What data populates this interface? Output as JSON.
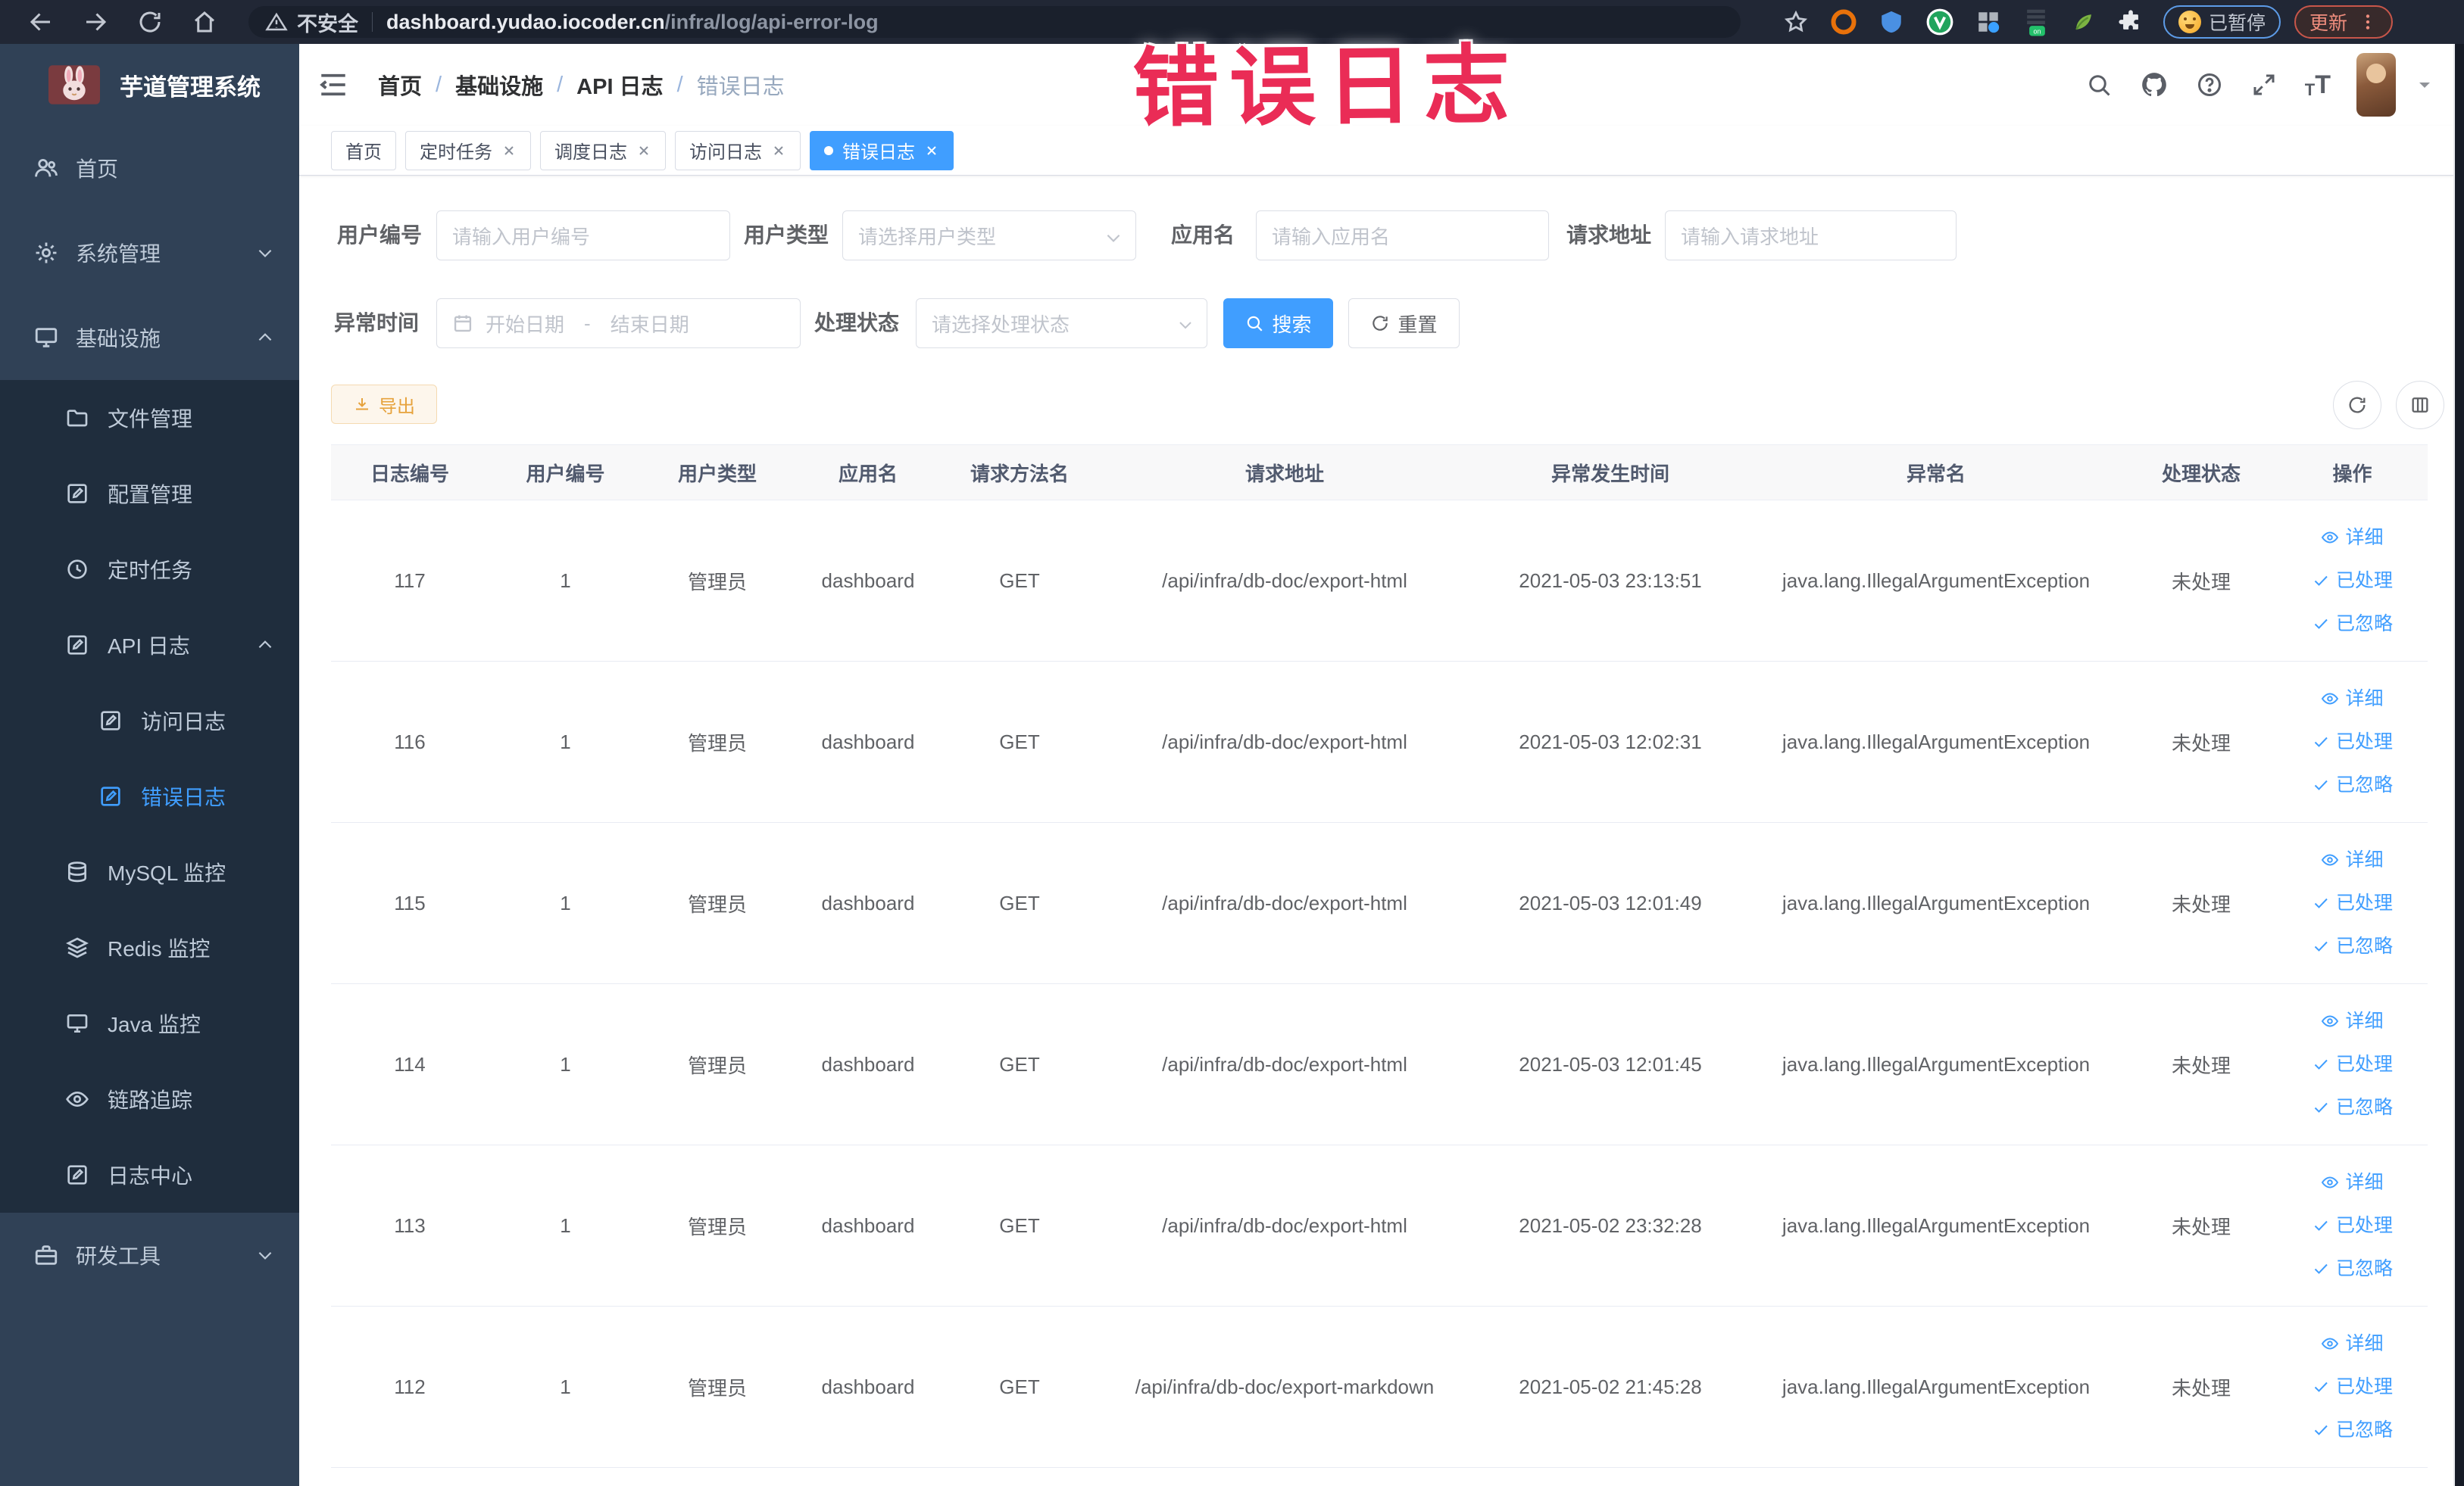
{
  "browser": {
    "security_label": "不安全",
    "url_host": "dashboard.yudao.iocoder.cn",
    "url_path": "/infra/log/api-error-log",
    "paused_badge": "已暂停",
    "update_button": "更新",
    "extensions": [
      {
        "name": "adblock-icon",
        "color": "#e8710a"
      },
      {
        "name": "shield-icon",
        "color": "#4a90e2"
      },
      {
        "name": "v-badge-icon",
        "color": "#21a45d"
      },
      {
        "name": "grid-icon",
        "color": "#9aa0a6"
      },
      {
        "name": "proxy-on-icon",
        "color": "#23c16b"
      },
      {
        "name": "leaf-icon",
        "color": "#7cb342"
      },
      {
        "name": "puzzle-icon",
        "color": "#e8eaed"
      }
    ]
  },
  "annotation": {
    "text": "错误日志",
    "color": "#ea2c56"
  },
  "sidebar": {
    "logo_title": "芋道管理系统",
    "menu": [
      {
        "label": "首页",
        "icon": "users-icon",
        "level": 1
      },
      {
        "label": "系统管理",
        "icon": "gear-icon",
        "level": 1,
        "chevron": "down"
      },
      {
        "label": "基础设施",
        "icon": "infra-icon",
        "level": 1,
        "chevron": "up"
      },
      {
        "label": "文件管理",
        "icon": "folder-icon",
        "level": 2,
        "group": true
      },
      {
        "label": "配置管理",
        "icon": "edit-icon",
        "level": 2,
        "group": true
      },
      {
        "label": "定时任务",
        "icon": "clock-icon",
        "level": 2,
        "group": true
      },
      {
        "label": "API 日志",
        "icon": "log-icon",
        "level": 2,
        "chevron": "up",
        "group": true
      },
      {
        "label": "访问日志",
        "icon": "log-icon",
        "level": 3,
        "group": true
      },
      {
        "label": "错误日志",
        "icon": "log-icon",
        "level": 3,
        "group": true,
        "active": true
      },
      {
        "label": "MySQL 监控",
        "icon": "database-icon",
        "level": 2,
        "group": true
      },
      {
        "label": "Redis 监控",
        "icon": "layers-icon",
        "level": 2,
        "group": true
      },
      {
        "label": "Java 监控",
        "icon": "monitor-icon",
        "level": 2,
        "group": true
      },
      {
        "label": "链路追踪",
        "icon": "eye-icon",
        "level": 2,
        "group": true
      },
      {
        "label": "日志中心",
        "icon": "log-icon",
        "level": 2,
        "group": true
      },
      {
        "label": "研发工具",
        "icon": "briefcase-icon",
        "level": 1,
        "chevron": "down"
      }
    ]
  },
  "navbar": {
    "breadcrumb": [
      "首页",
      "基础设施",
      "API 日志",
      "错误日志"
    ]
  },
  "tags": [
    {
      "label": "首页",
      "closable": false,
      "active": false
    },
    {
      "label": "定时任务",
      "closable": true,
      "active": false
    },
    {
      "label": "调度日志",
      "closable": true,
      "active": false
    },
    {
      "label": "访问日志",
      "closable": true,
      "active": false
    },
    {
      "label": "错误日志",
      "closable": true,
      "active": true
    }
  ],
  "filters": {
    "row1": [
      {
        "label": "用户编号",
        "type": "input",
        "placeholder": "请输入用户编号"
      },
      {
        "label": "用户类型",
        "type": "select",
        "placeholder": "请选择用户类型"
      },
      {
        "label": "应用名",
        "type": "input",
        "placeholder": "请输入应用名"
      },
      {
        "label": "请求地址",
        "type": "input",
        "placeholder": "请输入请求地址"
      }
    ],
    "row2": {
      "date_label": "异常时间",
      "date_start": "开始日期",
      "date_separator": "-",
      "date_end": "结束日期",
      "status_label": "处理状态",
      "status_placeholder": "请选择处理状态",
      "search_label": "搜索",
      "reset_label": "重置"
    }
  },
  "toolbar": {
    "export_label": "导出"
  },
  "table": {
    "headers": [
      "日志编号",
      "用户编号",
      "用户类型",
      "应用名",
      "请求方法名",
      "请求地址",
      "异常发生时间",
      "异常名",
      "处理状态",
      "操作"
    ],
    "action_labels": [
      "详细",
      "已处理",
      "已忽略"
    ],
    "rows": [
      {
        "id": "117",
        "user_id": "1",
        "user_type": "管理员",
        "app": "dashboard",
        "method": "GET",
        "url": "/api/infra/db-doc/export-html",
        "time": "2021-05-03 23:13:51",
        "exception": "java.lang.IllegalArgumentException",
        "status": "未处理"
      },
      {
        "id": "116",
        "user_id": "1",
        "user_type": "管理员",
        "app": "dashboard",
        "method": "GET",
        "url": "/api/infra/db-doc/export-html",
        "time": "2021-05-03 12:02:31",
        "exception": "java.lang.IllegalArgumentException",
        "status": "未处理"
      },
      {
        "id": "115",
        "user_id": "1",
        "user_type": "管理员",
        "app": "dashboard",
        "method": "GET",
        "url": "/api/infra/db-doc/export-html",
        "time": "2021-05-03 12:01:49",
        "exception": "java.lang.IllegalArgumentException",
        "status": "未处理"
      },
      {
        "id": "114",
        "user_id": "1",
        "user_type": "管理员",
        "app": "dashboard",
        "method": "GET",
        "url": "/api/infra/db-doc/export-html",
        "time": "2021-05-03 12:01:45",
        "exception": "java.lang.IllegalArgumentException",
        "status": "未处理"
      },
      {
        "id": "113",
        "user_id": "1",
        "user_type": "管理员",
        "app": "dashboard",
        "method": "GET",
        "url": "/api/infra/db-doc/export-html",
        "time": "2021-05-02 23:32:28",
        "exception": "java.lang.IllegalArgumentException",
        "status": "未处理"
      },
      {
        "id": "112",
        "user_id": "1",
        "user_type": "管理员",
        "app": "dashboard",
        "method": "GET",
        "url": "/api/infra/db-doc/export-markdown",
        "time": "2021-05-02 21:45:28",
        "exception": "java.lang.IllegalArgumentException",
        "status": "未处理"
      }
    ]
  }
}
